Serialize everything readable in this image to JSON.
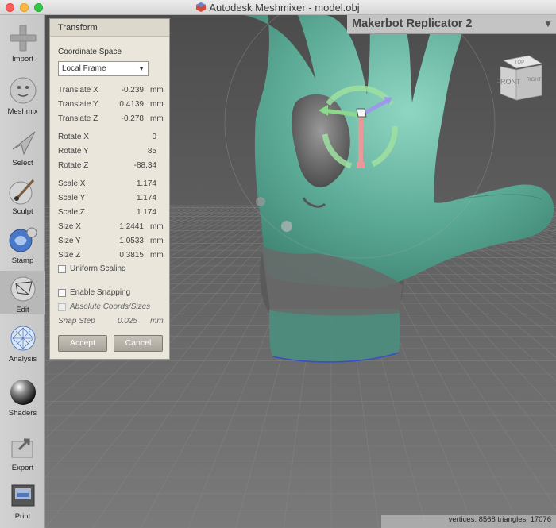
{
  "window": {
    "title": "Autodesk Meshmixer - model.obj"
  },
  "toolbar": {
    "tools": [
      {
        "label": "Import"
      },
      {
        "label": "Meshmix"
      },
      {
        "label": "Select"
      },
      {
        "label": "Sculpt"
      },
      {
        "label": "Stamp"
      },
      {
        "label": "Edit"
      },
      {
        "label": "Analysis"
      },
      {
        "label": "Shaders"
      },
      {
        "label": "Export"
      },
      {
        "label": "Print"
      }
    ],
    "selected": "Edit"
  },
  "printer": {
    "label": "Makerbot Replicator 2"
  },
  "navcube": {
    "top": "TOP",
    "front": "FRONT",
    "right": "RIGHT"
  },
  "status": {
    "text": "vertices: 8568 triangles: 17076"
  },
  "panel": {
    "title": "Transform",
    "coord_label": "Coordinate Space",
    "coord_value": "Local Frame",
    "fields": {
      "translate_x": {
        "label": "Translate X",
        "value": "-0.239",
        "unit": "mm"
      },
      "translate_y": {
        "label": "Translate Y",
        "value": "0.4139",
        "unit": "mm"
      },
      "translate_z": {
        "label": "Translate Z",
        "value": "-0.278",
        "unit": "mm"
      },
      "rotate_x": {
        "label": "Rotate X",
        "value": "0"
      },
      "rotate_y": {
        "label": "Rotate Y",
        "value": "85"
      },
      "rotate_z": {
        "label": "Rotate Z",
        "value": "-88.34"
      },
      "scale_x": {
        "label": "Scale X",
        "value": "1.174"
      },
      "scale_y": {
        "label": "Scale Y",
        "value": "1.174"
      },
      "scale_z": {
        "label": "Scale Z",
        "value": "1.174"
      },
      "size_x": {
        "label": "Size X",
        "value": "1.2441",
        "unit": "mm"
      },
      "size_y": {
        "label": "Size Y",
        "value": "1.0533",
        "unit": "mm"
      },
      "size_z": {
        "label": "Size Z",
        "value": "0.3815",
        "unit": "mm"
      }
    },
    "uniform_scaling": "Uniform Scaling",
    "enable_snapping": "Enable Snapping",
    "absolute_coords": "Absolute Coords/Sizes",
    "snap_step": {
      "label": "Snap Step",
      "value": "0.025",
      "unit": "mm"
    },
    "accept": "Accept",
    "cancel": "Cancel"
  }
}
